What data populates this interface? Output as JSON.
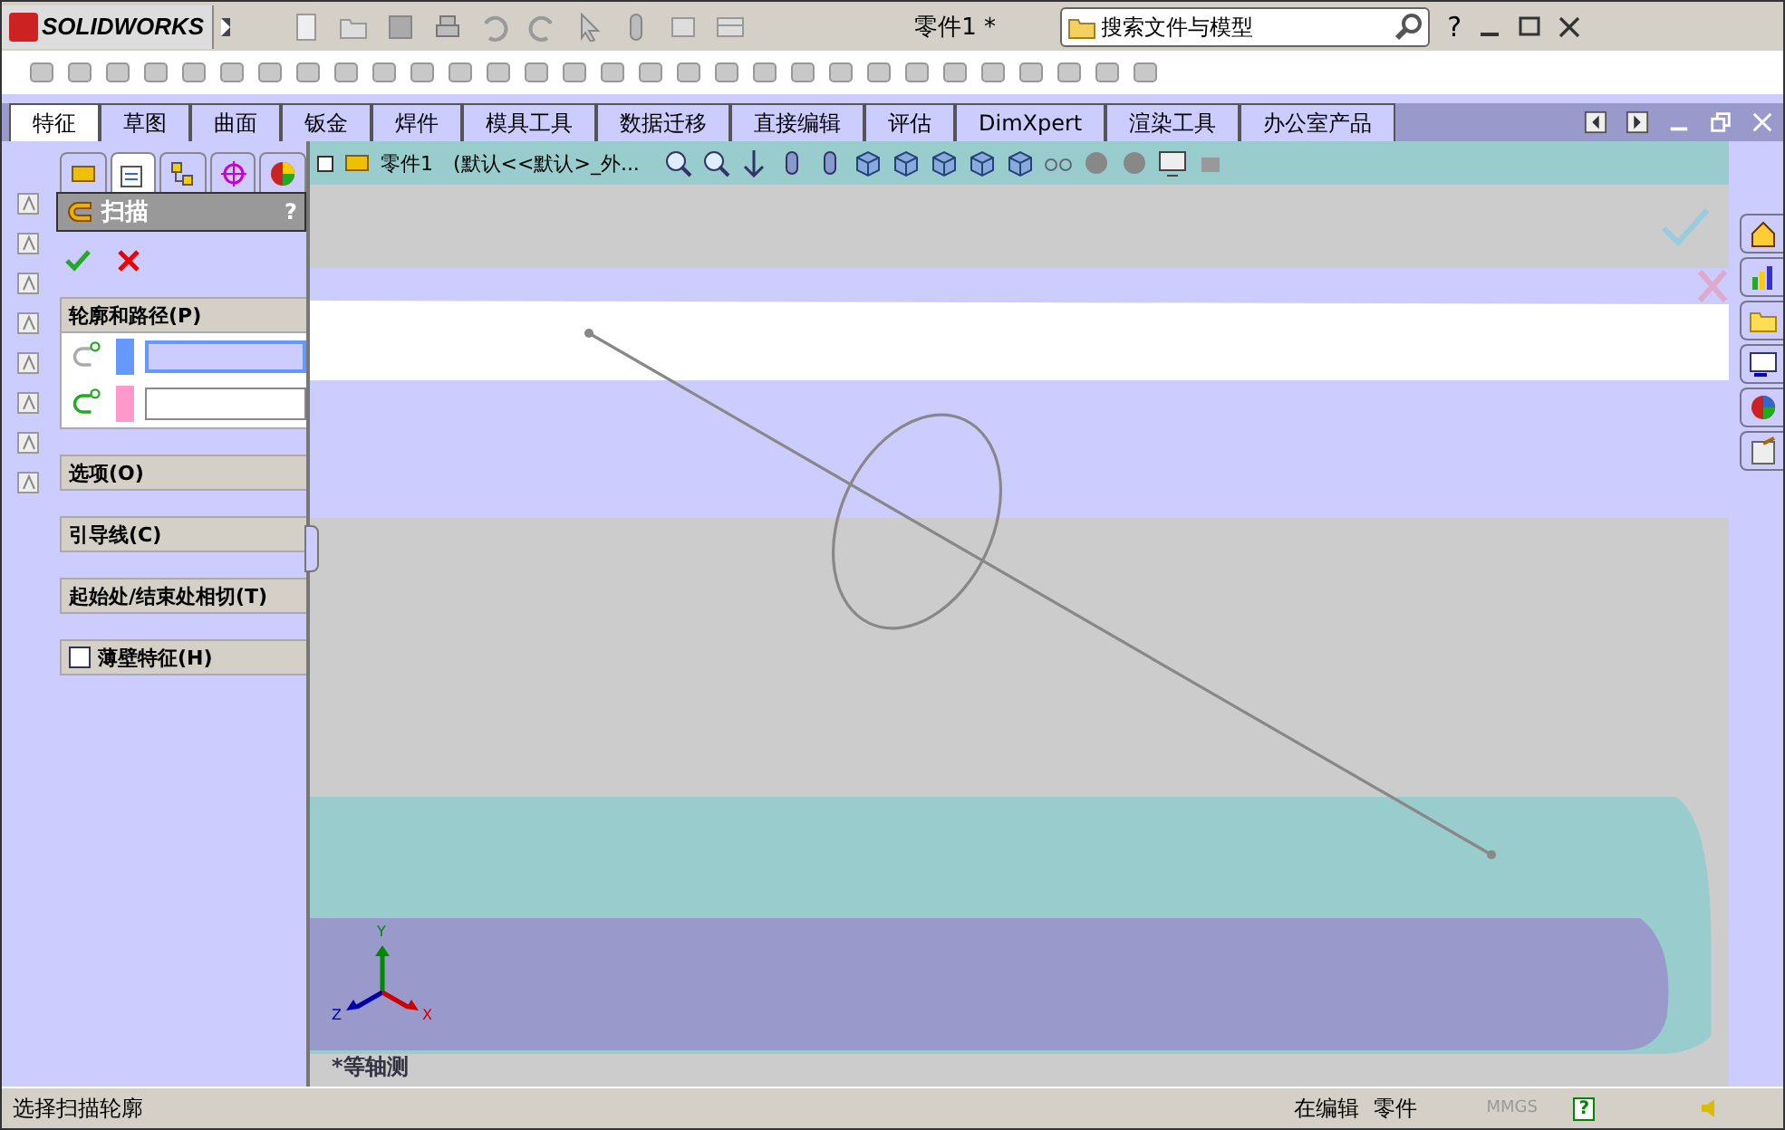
{
  "app": {
    "logo": "SOLIDWORKS"
  },
  "window": {
    "title": "零件1 *"
  },
  "search": {
    "placeholder": "搜索文件与模型"
  },
  "help": "?",
  "tabs": [
    {
      "label": "特征",
      "selected": true
    },
    {
      "label": "草图",
      "selected": false
    },
    {
      "label": "曲面",
      "selected": false
    },
    {
      "label": "钣金",
      "selected": false
    },
    {
      "label": "焊件",
      "selected": false
    },
    {
      "label": "模具工具",
      "selected": false
    },
    {
      "label": "数据迁移",
      "selected": false
    },
    {
      "label": "直接编辑",
      "selected": false
    },
    {
      "label": "评估",
      "selected": false
    },
    {
      "label": "DimXpert",
      "selected": false
    },
    {
      "label": "渲染工具",
      "selected": false
    },
    {
      "label": "办公室产品",
      "selected": false
    }
  ],
  "panel_tabs": [
    {
      "selected": false
    },
    {
      "selected": true
    },
    {
      "selected": false
    },
    {
      "selected": false
    },
    {
      "selected": false
    }
  ],
  "property_manager": {
    "title": "扫描",
    "help": "?",
    "sections": [
      {
        "kind": "selection",
        "title": "轮廓和路径(P)",
        "fields": [
          {
            "color": "#6699ff",
            "active": true
          },
          {
            "color": "#ff99cc",
            "active": false
          }
        ]
      },
      {
        "kind": "header",
        "title": "选项(O)"
      },
      {
        "kind": "header",
        "title": "引导线(C)"
      },
      {
        "kind": "header",
        "title": "起始处/结束处相切(T)"
      },
      {
        "kind": "checkbox",
        "title": "薄壁特征(H)",
        "checked": false
      }
    ]
  },
  "tree": {
    "root": "零件1",
    "config": "(默认<<默认>_外..."
  },
  "view": {
    "orientation": "*等轴测",
    "axes": [
      "Y",
      "Z",
      "X"
    ]
  },
  "status_bar": {
    "message": "选择扫描轮廓",
    "mode": "在编辑",
    "document": "零件",
    "units": "MMGS",
    "help": "?"
  }
}
